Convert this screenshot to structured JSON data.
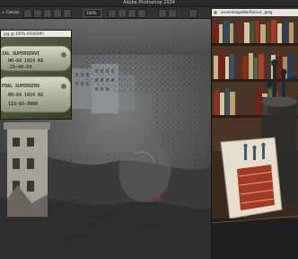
{
  "app": {
    "title": "Adobe Photoshop 2024"
  },
  "options_bar": {
    "zoom_text": "≡ Canvas",
    "zoom_percent": "100%",
    "fields": [
      "",
      ""
    ]
  },
  "documents": {
    "tags_window_title": ".jpg @ 100% (RGB/8#)",
    "figurines_window_title": "assemblageWarRacket_.jpeg"
  },
  "tags_image": {
    "lines": [
      "IAL SUPERSERVI",
      "HH-64 1024 KG",
      "23-40-24",
      "FOAL SUPERSERV",
      "HH-64 1024 KG",
      "123-65-8000"
    ]
  },
  "colors": {
    "canvas_bg": "#4b4d4c",
    "ui_dark": "#2b2b2b",
    "book_red": "#7a1f17"
  }
}
